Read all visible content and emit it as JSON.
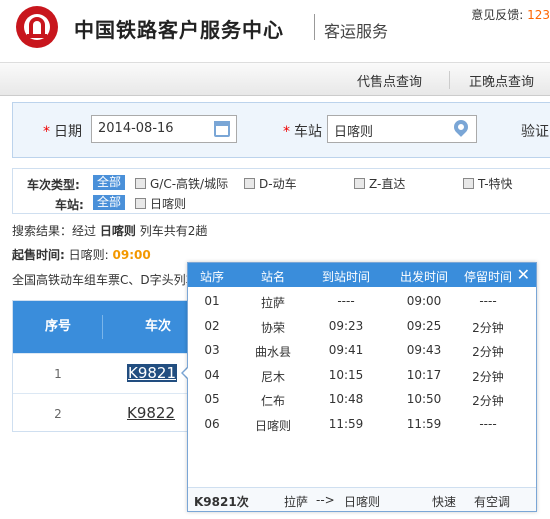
{
  "header": {
    "brand": "中国铁路客户服务中心",
    "sub": "客运服务",
    "feedback_label": "意见反馈:",
    "feedback_count": "123"
  },
  "nav": {
    "items": [
      "代售点查询",
      "正晚点查询"
    ]
  },
  "search": {
    "date_label": "日期",
    "date_value": "2014-08-16",
    "station_label": "车站",
    "station_value": "日喀则",
    "verify_label": "验证"
  },
  "filter": {
    "type_label": "车次类型:",
    "all_label": "全部",
    "types": [
      "G/C-高铁/城际",
      "D-动车",
      "Z-直达",
      "T-特快"
    ],
    "station_label": "车站:",
    "stations": [
      "日喀则"
    ]
  },
  "result": {
    "prefix": "搜索结果：经过",
    "station": "日喀则",
    "suffix": "列车共有2趟",
    "sale_label": "起售时间:",
    "sale_station": "日喀则:",
    "sale_time": "09:00",
    "notice": "全国高铁动车组车票C、D字头列车"
  },
  "table": {
    "headers": [
      "序号",
      "车次"
    ],
    "rows": [
      {
        "seq": "1",
        "train": "K9821"
      },
      {
        "seq": "2",
        "train": "K9822"
      }
    ]
  },
  "popup": {
    "headers": [
      "站序",
      "站名",
      "到站时间",
      "出发时间",
      "停留时间"
    ],
    "close": "✕",
    "rows": [
      {
        "no": "01",
        "name": "拉萨",
        "arrive": "----",
        "depart": "09:00",
        "stay": "----"
      },
      {
        "no": "02",
        "name": "协荣",
        "arrive": "09:23",
        "depart": "09:25",
        "stay": "2分钟"
      },
      {
        "no": "03",
        "name": "曲水县",
        "arrive": "09:41",
        "depart": "09:43",
        "stay": "2分钟"
      },
      {
        "no": "04",
        "name": "尼木",
        "arrive": "10:15",
        "depart": "10:17",
        "stay": "2分钟"
      },
      {
        "no": "05",
        "name": "仁布",
        "arrive": "10:48",
        "depart": "10:50",
        "stay": "2分钟"
      },
      {
        "no": "06",
        "name": "日喀则",
        "arrive": "11:59",
        "depart": "11:59",
        "stay": "----"
      }
    ],
    "footer": {
      "train": "K9821次",
      "from": "拉萨",
      "arrow": "-->",
      "to": "日喀则",
      "speed": "快速",
      "ac": "有空调"
    }
  }
}
